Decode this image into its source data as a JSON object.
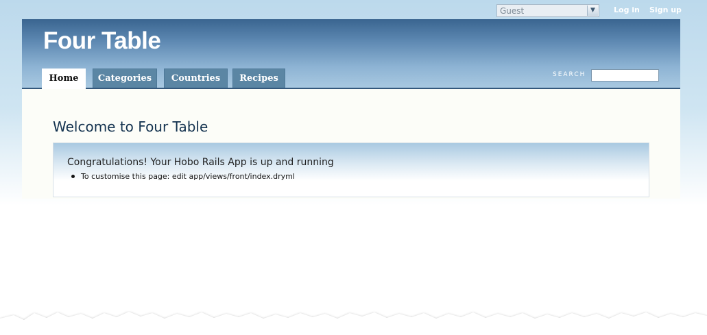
{
  "account": {
    "user_select_value": "Guest",
    "login_label": "Log in",
    "signup_label": "Sign up"
  },
  "header": {
    "app_name": "Four Table",
    "search_label": "SEARCH",
    "search_value": ""
  },
  "nav": {
    "tabs": [
      {
        "label": "Home",
        "current": true
      },
      {
        "label": "Categories",
        "current": false
      },
      {
        "label": "Countries",
        "current": false
      },
      {
        "label": "Recipes",
        "current": false
      }
    ]
  },
  "content": {
    "page_title": "Welcome to Four Table",
    "welcome_heading": "Congratulations! Your Hobo Rails App is up and running",
    "hints": [
      "To customise this page: edit app/views/front/index.dryml"
    ]
  },
  "colors": {
    "header_dark": "#3a6590",
    "tab_bg": "#5b86a4",
    "title_text": "#13324f"
  }
}
